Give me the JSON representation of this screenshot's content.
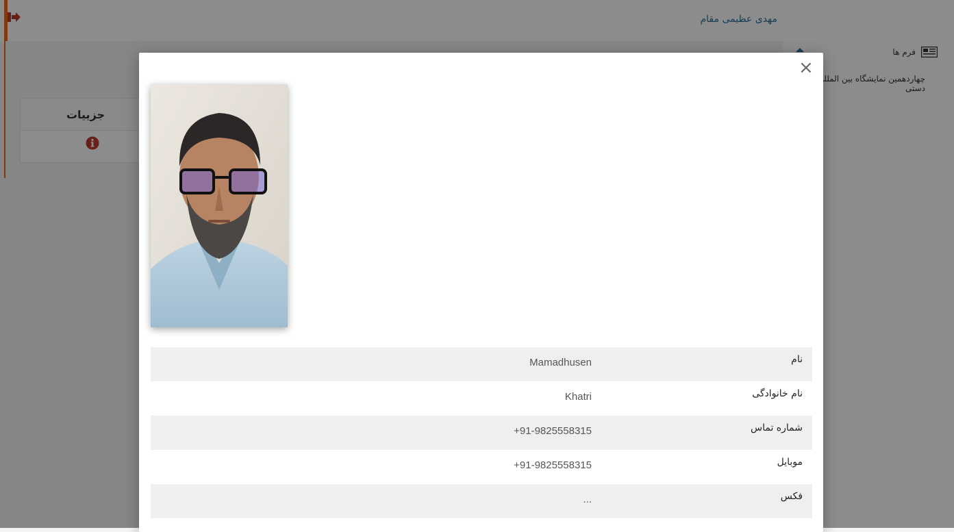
{
  "header": {
    "user_name": "مهدی عظیمی مقام",
    "logout_icon": "sign-out-icon"
  },
  "sidebar": {
    "forms_label": "فرم ها",
    "forms_icon": "newspaper-icon",
    "exhibition_title": "چهاردهمین نمایشگاه بین المللی صنایع دستی"
  },
  "details_card": {
    "header": "جزییات",
    "info_icon": "info-circle-icon"
  },
  "modal": {
    "close_label": "×",
    "photo_alt": "profile-photo",
    "rows": [
      {
        "label": "نام",
        "value": "Mamadhusen"
      },
      {
        "label": "نام خانوادگی",
        "value": "Khatri"
      },
      {
        "label": "شماره تماس",
        "value": "+91-9825558315"
      },
      {
        "label": "موبایل",
        "value": "+91-9825558315"
      },
      {
        "label": "فکس",
        "value": "..."
      }
    ]
  },
  "colors": {
    "accent": "#e96b1f",
    "link": "#2a6f97",
    "danger": "#c0392b"
  }
}
